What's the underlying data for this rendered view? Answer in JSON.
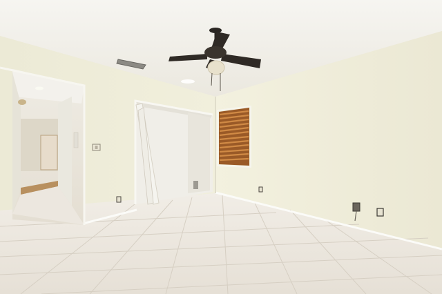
{
  "scene": {
    "description_type": "photo",
    "colors": {
      "ceiling": "#f4f2ec",
      "wall_left": "#efedd9",
      "wall_right": "#f1efdc",
      "closet_interior": "#f0eee8",
      "floor": "#ece7df",
      "grout": "#d9d2c6",
      "hallway_wall": "#e9e7e0",
      "hallway_floor": "#b48a5c",
      "blinds": "#b87236",
      "fan_blades": "#2b2723",
      "fan_globe": "#e8e1cc",
      "baseboard": "#ffffff"
    },
    "icons": [
      "ceiling-fan-icon",
      "window-blinds-icon",
      "air-vent-icon",
      "light-switch-icon",
      "outlet-icon"
    ]
  }
}
